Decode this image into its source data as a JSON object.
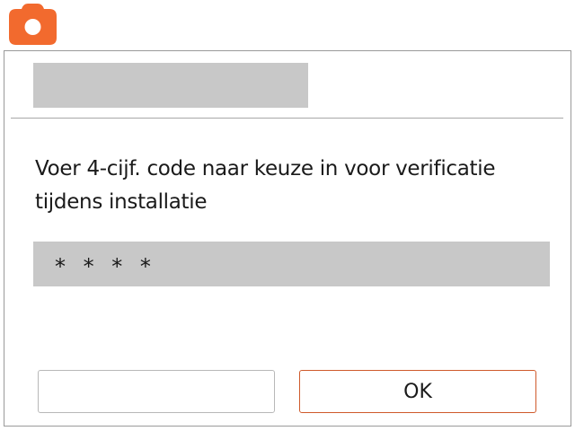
{
  "app": {
    "icon": "camera-icon",
    "accent_color": "#f26a2e"
  },
  "dialog": {
    "title": "",
    "message": "Voer 4-cijf. code naar keuze in voor verificatie tijdens installatie",
    "pin_value": "* * * *",
    "buttons": {
      "left_label": "",
      "ok_label": "OK"
    }
  }
}
